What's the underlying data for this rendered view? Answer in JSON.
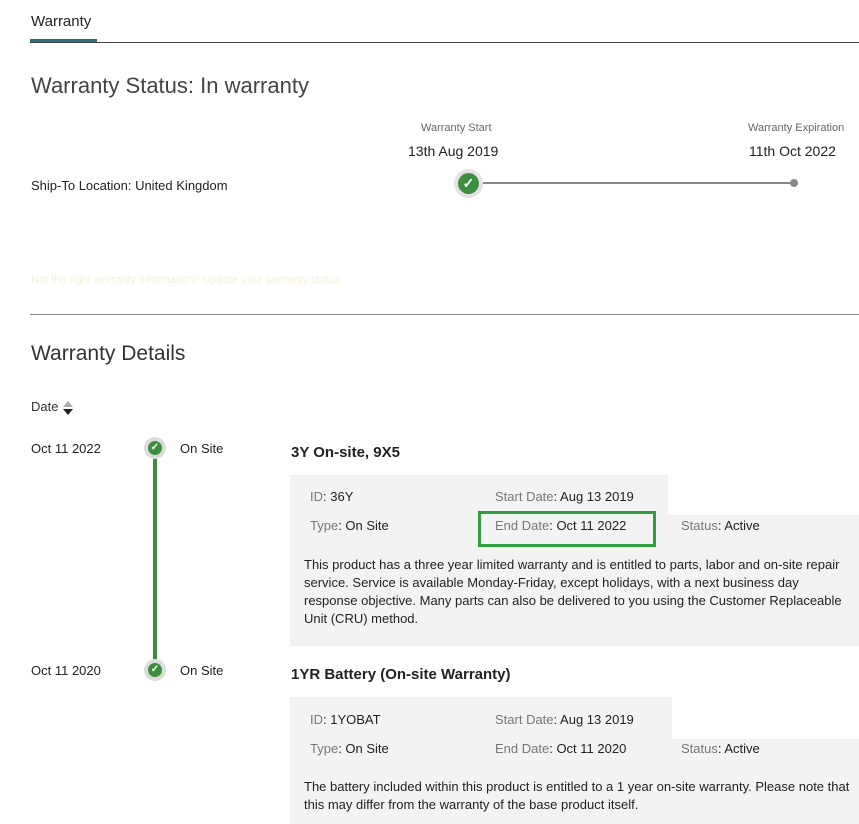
{
  "tabs": {
    "warranty_label": "Warranty"
  },
  "warranty_status": {
    "title": "Warranty Status: In warranty",
    "start_label": "Warranty Start",
    "start_date": "13th Aug 2019",
    "expiration_label": "Warranty Expiration",
    "expiration_date": "11th Oct 2022",
    "ship_to": "Ship-To Location: United Kingdom",
    "faded_text": "Not the right warranty information? Update your warranty status"
  },
  "details": {
    "title": "Warranty Details",
    "sort_label": "Date",
    "rows": [
      {
        "date": "Oct 11 2022",
        "type": "On Site",
        "name": "3Y On-site, 9X5",
        "id_label": "ID",
        "id": "36Y",
        "start_label": "Start Date",
        "start": "Aug 13 2019",
        "type_label": "Type",
        "type_value": "On Site",
        "end_label": "End Date",
        "end": "Oct 11 2022",
        "status_label": "Status",
        "status": "Active",
        "description": "This product has a three year limited warranty and is entitled to parts, labor and on-site repair service. Service is available Monday-Friday, except holidays, with a next business day response objective. Many parts can also be delivered to you using the Customer Replaceable Unit (CRU) method."
      },
      {
        "date": "Oct 11 2020",
        "type": "On Site",
        "name": "1YR Battery (On-site Warranty)",
        "id_label": "ID",
        "id": "1YOBAT",
        "start_label": "Start Date",
        "start": "Aug 13 2019",
        "type_label": "Type",
        "type_value": "On Site",
        "end_label": "End Date",
        "end": "Oct 11 2020",
        "status_label": "Status",
        "status": "Active",
        "description": "The battery included within this product is entitled to a 1 year on-site warranty. Please note that this may differ from the warranty of the base product itself."
      }
    ]
  },
  "colors": {
    "accent": "#2c6e86",
    "success": "#3e8e3e",
    "highlight": "#2f9e3f"
  },
  "icons": {
    "check": "check-icon",
    "sort": "sort-arrows-icon"
  }
}
